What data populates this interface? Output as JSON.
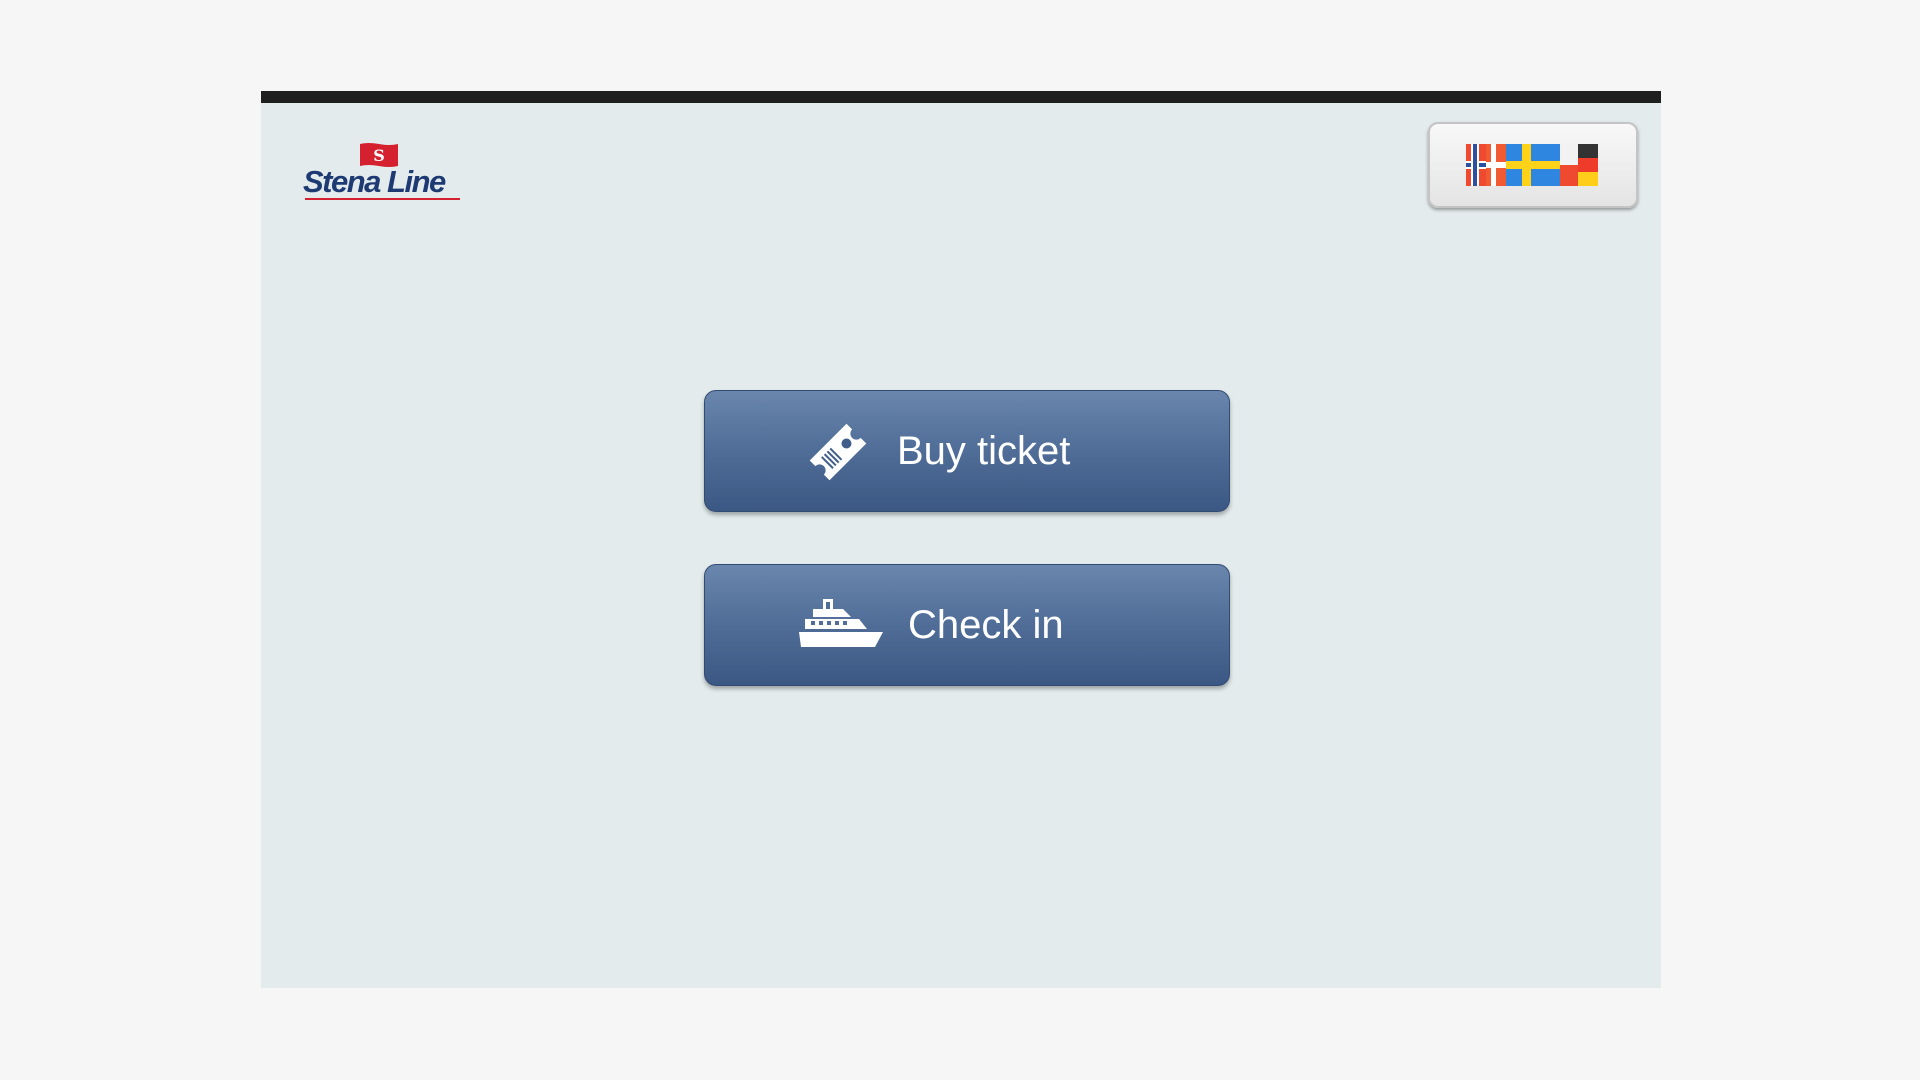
{
  "brand": {
    "name": "Stena Line",
    "flag_letter": "S",
    "colors": {
      "navy": "#1d3a73",
      "red": "#d4202f"
    }
  },
  "language_selector": {
    "icon": "flags-icon",
    "flags": [
      "norway",
      "denmark",
      "sweden",
      "poland",
      "germany"
    ]
  },
  "actions": {
    "buy_ticket": {
      "label": "Buy ticket",
      "icon": "ticket-icon"
    },
    "check_in": {
      "label": "Check in",
      "icon": "ship-icon"
    }
  },
  "colors": {
    "page_background": "#f6f6f6",
    "panel_background": "#e3ebec",
    "top_bar": "#1f1f1f",
    "button_top": "#6a86ad",
    "button_bottom": "#3a5883"
  }
}
